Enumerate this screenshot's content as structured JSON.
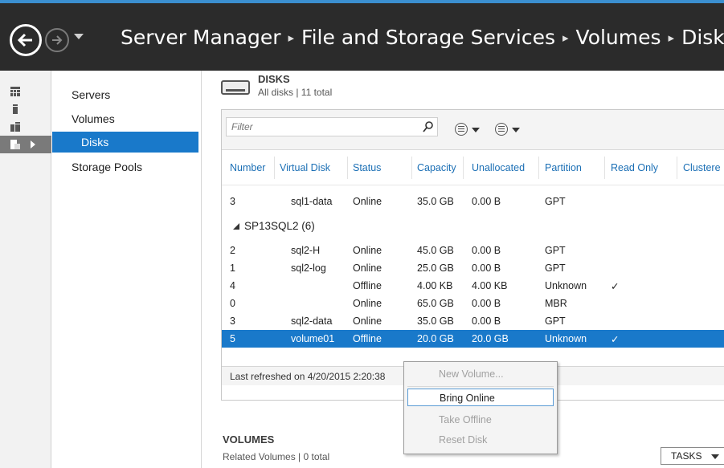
{
  "header": {
    "crumbs": [
      "Server Manager",
      "File and Storage Services",
      "Volumes",
      "Disks"
    ],
    "separator": "▸"
  },
  "rail": {
    "icons": [
      "dashboard-icon",
      "local-server-icon",
      "all-servers-icon",
      "file-storage-icon"
    ]
  },
  "nav": {
    "items": [
      {
        "label": "Servers"
      },
      {
        "label": "Volumes"
      },
      {
        "label": "Disks"
      },
      {
        "label": "Storage Pools"
      }
    ]
  },
  "disks": {
    "title": "DISKS",
    "subtitle": "All disks | 11 total",
    "filter_placeholder": "Filter",
    "columns": [
      "Number",
      "Virtual Disk",
      "Status",
      "Capacity",
      "Unallocated",
      "Partition",
      "Read Only",
      "Clustere"
    ],
    "rows_top": [
      {
        "number": "3",
        "virtual_disk": "sql1-data",
        "status": "Online",
        "capacity": "35.0 GB",
        "unallocated": "0.00 B",
        "partition": "GPT",
        "read_only": ""
      }
    ],
    "group": {
      "label": "SP13SQL2 (6)"
    },
    "rows_group": [
      {
        "number": "2",
        "virtual_disk": "sql2-H",
        "status": "Online",
        "capacity": "45.0 GB",
        "unallocated": "0.00 B",
        "partition": "GPT",
        "read_only": ""
      },
      {
        "number": "1",
        "virtual_disk": "sql2-log",
        "status": "Online",
        "capacity": "25.0 GB",
        "unallocated": "0.00 B",
        "partition": "GPT",
        "read_only": ""
      },
      {
        "number": "4",
        "virtual_disk": "",
        "status": "Offline",
        "capacity": "4.00 KB",
        "unallocated": "4.00 KB",
        "partition": "Unknown",
        "read_only": "✓"
      },
      {
        "number": "0",
        "virtual_disk": "",
        "status": "Online",
        "capacity": "65.0 GB",
        "unallocated": "0.00 B",
        "partition": "MBR",
        "read_only": ""
      },
      {
        "number": "3",
        "virtual_disk": "sql2-data",
        "status": "Online",
        "capacity": "35.0 GB",
        "unallocated": "0.00 B",
        "partition": "GPT",
        "read_only": ""
      },
      {
        "number": "5",
        "virtual_disk": "volume01",
        "status": "Offline",
        "capacity": "20.0 GB",
        "unallocated": "20.0 GB",
        "partition": "Unknown",
        "read_only": "✓"
      }
    ],
    "refreshed": "Last refreshed on 4/20/2015 2:20:38"
  },
  "volumes": {
    "title": "VOLUMES",
    "subtitle": "Related Volumes | 0 total",
    "tasks_label": "TASKS"
  },
  "context_menu": {
    "items": [
      {
        "label": "New Volume...",
        "state": "disabled"
      },
      {
        "label": "Bring Online",
        "state": "active"
      },
      {
        "label": "Take Offline",
        "state": "disabled"
      },
      {
        "label": "Reset Disk",
        "state": "disabled"
      }
    ]
  },
  "colors": {
    "header_bg": "#2b2b2b",
    "accent": "#1979ca",
    "link": "#1b6fb5"
  }
}
